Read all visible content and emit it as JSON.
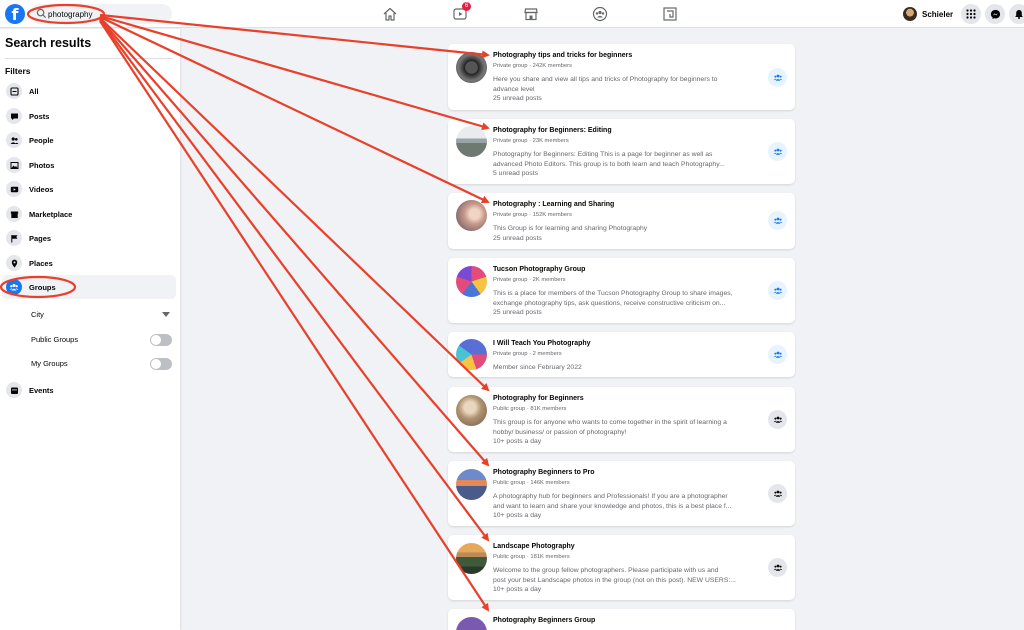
{
  "topbar": {
    "logo_letter": "f",
    "search": {
      "value": "photography",
      "placeholder": "Search Facebook"
    },
    "nav": [
      {
        "name": "home-icon"
      },
      {
        "name": "watch-icon",
        "badge": "6"
      },
      {
        "name": "marketplace-icon"
      },
      {
        "name": "groups-icon"
      },
      {
        "name": "gaming-icon"
      }
    ],
    "profile_name": "Schieler",
    "buttons": [
      "menu-grid-icon",
      "messenger-icon",
      "notifications-icon"
    ]
  },
  "sidebar": {
    "title": "Search results",
    "filters_label": "Filters",
    "items": [
      {
        "label": "All",
        "icon": "all-icon"
      },
      {
        "label": "Posts",
        "icon": "posts-icon"
      },
      {
        "label": "People",
        "icon": "people-icon"
      },
      {
        "label": "Photos",
        "icon": "photos-icon"
      },
      {
        "label": "Videos",
        "icon": "videos-icon"
      },
      {
        "label": "Marketplace",
        "icon": "marketplace-icon"
      },
      {
        "label": "Pages",
        "icon": "pages-icon"
      },
      {
        "label": "Places",
        "icon": "places-icon"
      },
      {
        "label": "Groups",
        "icon": "groups-icon",
        "active": true
      }
    ],
    "group_filters": {
      "city": "City",
      "public_groups": "Public Groups",
      "my_groups": "My Groups"
    },
    "events": {
      "label": "Events",
      "icon": "events-icon"
    }
  },
  "results": [
    {
      "title": "Photography tips and tricks for beginners",
      "meta": "Private group · 242K members",
      "desc": [
        "Here you share and view all tips and tricks of Photography for beginners to",
        "advance level"
      ],
      "footer": "25 unread posts",
      "action": "blue"
    },
    {
      "title": "Photography for Beginners: Editing",
      "meta": "Private group · 23K members",
      "desc": [
        "Photography for Beginners: Editing This is a page for beginner as well as",
        "advanced Photo Editors. This group is to both learn and teach Photography..."
      ],
      "footer": "5 unread posts",
      "action": "blue"
    },
    {
      "title": "Photography : Learning and Sharing",
      "meta": "Private group · 152K members",
      "desc": [
        "This Group is for learning and sharing Photography"
      ],
      "footer": "25 unread posts",
      "action": "blue"
    },
    {
      "title": "Tucson Photography Group",
      "meta": "Private group · 2K members",
      "desc": [
        "This is a place for members of the Tucson Photography Group to share images,",
        "exchange photography tips, ask questions, receive constructive criticism on..."
      ],
      "footer": "25 unread posts",
      "action": "blue"
    },
    {
      "title": "I Will Teach You Photography",
      "meta": "Private group · 2 members",
      "desc": [
        "Member since February 2022"
      ],
      "footer": "",
      "action": "blue"
    },
    {
      "title": "Photography for Beginners",
      "meta": "Public group · 81K members",
      "desc": [
        "This group is for anyone who wants to come together in the spirit of learning a",
        "hobby/ business/ or passion of photography!"
      ],
      "footer": "10+ posts a day",
      "action": "grey"
    },
    {
      "title": "Photography Beginners to Pro",
      "meta": "Public group · 146K members",
      "desc": [
        "A photography hub for beginners and Professionals! If you are a photographer",
        "and want to learn and share your knowledge and photos, this is a best place f..."
      ],
      "footer": "10+ posts a day",
      "action": "grey"
    },
    {
      "title": "Landscape Photography",
      "meta": "Public group · 181K members",
      "desc": [
        "Welcome to the group fellow photographers. Please participate with us and",
        "post your best Landscape photos in the group (not on this post). NEW USERS:..."
      ],
      "footer": "10+ posts a day",
      "action": "grey"
    },
    {
      "title": "Photography Beginners Group",
      "meta": "",
      "desc": [],
      "footer": "",
      "action": "grey"
    }
  ],
  "colors": {
    "brand": "#1877f2",
    "annotation": "#e8402a",
    "badge": "#e41e3f"
  }
}
